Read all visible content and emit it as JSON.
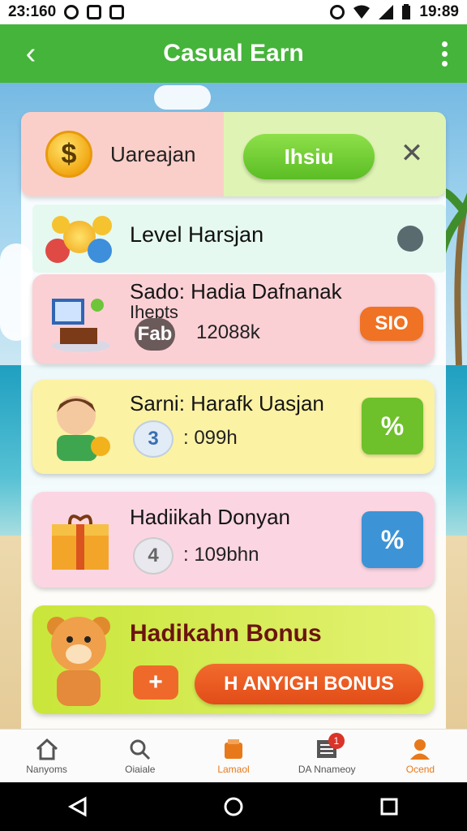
{
  "status_bar": {
    "time_left": "23:160",
    "time_right": "19:89"
  },
  "app_bar": {
    "back_glyph": "‹",
    "title": "Casual Earn"
  },
  "banner": {
    "coin_glyph": "$",
    "label": "Uareajan",
    "button_label": "Ihsiu",
    "close_glyph": "✕"
  },
  "level_row": {
    "label": "Level Harsjan"
  },
  "cards": [
    {
      "title": "Sado: Hadia Dafnanak",
      "subtitle": "Ihepts",
      "badge": "Fab",
      "value": "12088k",
      "button": "SIO",
      "bg": "#fbd0d5",
      "button_color": "#f07224"
    },
    {
      "title": "Sarni: Harafk Uasjan",
      "badge": "3",
      "value": ": 099h",
      "button": "%",
      "bg": "#fbf2a4",
      "button_color": "#6ec12a"
    },
    {
      "title": "Hadiikah Donyan",
      "badge": "4",
      "value": ": 109bhn",
      "button": "%",
      "bg": "#fcd5e3",
      "button_color": "#3c94d6"
    }
  ],
  "bonus_card": {
    "title": "Hadikahn Bonus",
    "button": "H ANYIGH BONUS",
    "badge_glyph": "+"
  },
  "bottom_nav": [
    {
      "label": "Nanyoms",
      "icon": "home-icon"
    },
    {
      "label": "Oiaiale",
      "icon": "search-icon"
    },
    {
      "label": "Lamaol",
      "icon": "basket-icon"
    },
    {
      "label": "DA Nnameoy",
      "icon": "list-icon",
      "notif": "1"
    },
    {
      "label": "Ocend",
      "icon": "profile-icon"
    }
  ],
  "colors": {
    "accent": "#45b43a",
    "active_nav": "#e8791a"
  }
}
